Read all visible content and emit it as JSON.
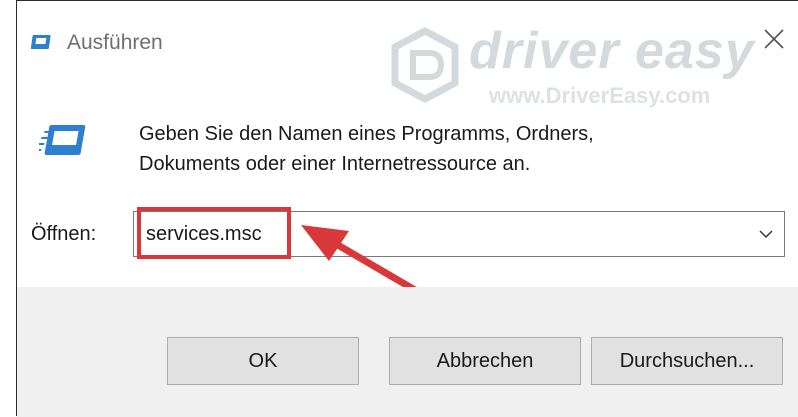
{
  "window": {
    "title": "Ausführen",
    "close_label": "×"
  },
  "watermark": {
    "brand": "driver easy",
    "url": "www.DriverEasy.com"
  },
  "dialog": {
    "description_line1": "Geben Sie den Namen eines Programms, Ordners,",
    "description_line2": "Dokuments oder einer Internetressource an.",
    "open_label": "Öffnen:",
    "open_value": "services.msc"
  },
  "buttons": {
    "ok": "OK",
    "cancel": "Abbrechen",
    "browse": "Durchsuchen..."
  },
  "icons": {
    "run_icon": "run-dialog-icon",
    "close_icon": "close-icon",
    "dropdown_icon": "chevron-down-icon",
    "annotation_arrow": "red-arrow-icon"
  },
  "colors": {
    "highlight": "#d9383a",
    "icon_blue": "#2f7fd1",
    "button_bg": "#e1e1e1",
    "footer_bg": "#f0f0f0"
  }
}
